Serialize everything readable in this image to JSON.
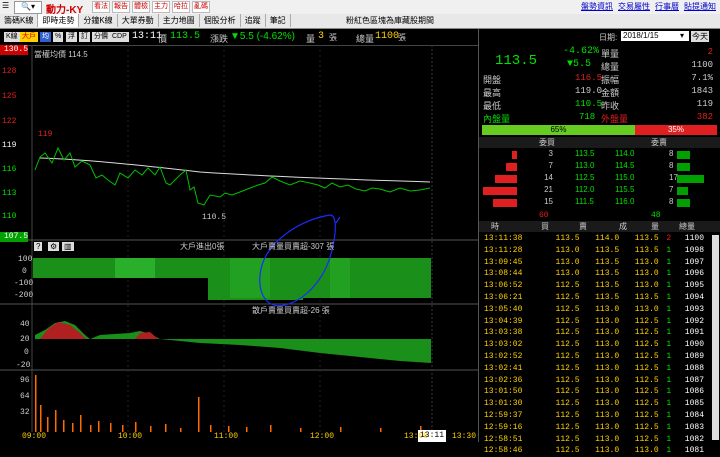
{
  "app": {
    "stock_name": "動力-KY",
    "menu": [
      "看法",
      "報告",
      "體檢",
      "主力",
      "哈拉",
      "亂碼"
    ],
    "right_links": [
      "盤勢資訊",
      "交易屬性",
      "行事曆",
      "貼提通知"
    ]
  },
  "tabs": [
    "籌碼K線",
    "即時走勢",
    "分鐘K線",
    "大單券動",
    "主力地圖",
    "個股分析",
    "追蹤",
    "筆記"
  ],
  "notice": "粉紅色區塊為庫藏股期間",
  "chart_toolbar": {
    "buttons": [
      "K線",
      "大戶",
      "均",
      "%",
      "浮",
      "訂",
      "分價",
      "CDP"
    ],
    "time": "13:11",
    "price_label": "價",
    "price": "113.5",
    "change_label": "漲跌",
    "change": "▼5.5 (-4.62%)",
    "volume_label": "量",
    "volume": "3",
    "volume_unit": "張",
    "total_label": "總量",
    "total": "1100",
    "total_unit": "張"
  },
  "main_chart": {
    "avg_label": "當權均價 114.5",
    "y_labels": [
      "130.5",
      "128",
      "125",
      "122",
      "119",
      "116",
      "113",
      "110",
      "107.5"
    ],
    "high_marker": "119",
    "low_marker": "110.5",
    "ref_price": "119",
    "top_label": "130.5",
    "bottom_label": "107.5"
  },
  "sub1": {
    "label1": "大戶進出0張",
    "label2": "大戶賣量買賣超-307 張",
    "label3": "散戶賣量買賣超-26 張",
    "y_labels": [
      "100",
      "0",
      "-100",
      "-200",
      "-300"
    ]
  },
  "sub2": {
    "y_labels": [
      "40",
      "20",
      "0",
      "-20"
    ]
  },
  "sub3": {
    "y_labels": [
      "96",
      "64",
      "32"
    ]
  },
  "x_axis": {
    "labels": [
      "09:00",
      "10:00",
      "11:00",
      "12:00",
      "13:00",
      "13:30"
    ],
    "cursor": "13:11"
  },
  "right_panel": {
    "date_label": "日期:",
    "date": "2018/1/15",
    "today_btn": "今天",
    "price": "113.5",
    "pct": "-4.62%",
    "change": "▼5.5",
    "vol_label": "單量",
    "vol": "2",
    "total_label": "總量",
    "total": "1100",
    "stats": [
      {
        "k1": "開盤",
        "v1": "116.5",
        "k2": "振幅",
        "v2": "7.1%"
      },
      {
        "k1": "最高",
        "v1": "119.0",
        "k2": "金額",
        "v2": "1843"
      },
      {
        "k1": "最低",
        "v1": "110.5",
        "k2": "昨收",
        "v2": "119"
      }
    ],
    "inner_label": "內盤量",
    "inner": "718",
    "outer_label": "外盤量",
    "outer": "382",
    "inner_pct": "65%",
    "outer_pct": "35%",
    "bid_title": "委買",
    "ask_title": "委賣",
    "book": [
      {
        "bq": "3",
        "bp": "113.5",
        "ap": "114.0",
        "aq": "8"
      },
      {
        "bq": "7",
        "bp": "113.0",
        "ap": "114.5",
        "aq": "8"
      },
      {
        "bq": "14",
        "bp": "112.5",
        "ap": "115.0",
        "aq": "17"
      },
      {
        "bq": "21",
        "bp": "112.0",
        "ap": "115.5",
        "aq": "7"
      },
      {
        "bq": "15",
        "bp": "111.5",
        "ap": "116.0",
        "aq": "8"
      }
    ],
    "book_total_bid": "60",
    "book_total_ask": "48",
    "tick_headers": [
      "時",
      "買",
      "賣",
      "成",
      "量",
      "總量"
    ],
    "ticks": [
      [
        "13:11:38",
        "113.5",
        "114.0",
        "113.5",
        "2",
        "1100"
      ],
      [
        "13:11:28",
        "113.0",
        "113.5",
        "113.5",
        "1",
        "1098"
      ],
      [
        "13:09:45",
        "113.0",
        "113.5",
        "113.0",
        "1",
        "1097"
      ],
      [
        "13:08:44",
        "113.0",
        "113.5",
        "113.0",
        "1",
        "1096"
      ],
      [
        "13:06:52",
        "112.5",
        "113.5",
        "113.0",
        "1",
        "1095"
      ],
      [
        "13:06:21",
        "112.5",
        "113.5",
        "113.5",
        "1",
        "1094"
      ],
      [
        "13:05:40",
        "112.5",
        "113.0",
        "113.0",
        "1",
        "1093"
      ],
      [
        "13:04:39",
        "112.5",
        "113.0",
        "112.5",
        "1",
        "1092"
      ],
      [
        "13:03:38",
        "112.5",
        "113.0",
        "112.5",
        "1",
        "1091"
      ],
      [
        "13:03:02",
        "112.5",
        "113.0",
        "112.5",
        "1",
        "1090"
      ],
      [
        "13:02:52",
        "112.5",
        "113.0",
        "112.5",
        "1",
        "1089"
      ],
      [
        "13:02:41",
        "112.5",
        "113.0",
        "112.5",
        "1",
        "1088"
      ],
      [
        "13:02:36",
        "112.5",
        "113.0",
        "112.5",
        "1",
        "1087"
      ],
      [
        "13:01:50",
        "112.5",
        "113.0",
        "112.5",
        "1",
        "1086"
      ],
      [
        "13:01:30",
        "112.5",
        "113.0",
        "112.5",
        "1",
        "1085"
      ],
      [
        "12:59:37",
        "112.5",
        "113.0",
        "112.5",
        "1",
        "1084"
      ],
      [
        "12:59:16",
        "112.5",
        "113.0",
        "112.5",
        "1",
        "1083"
      ],
      [
        "12:58:51",
        "112.5",
        "113.0",
        "112.5",
        "1",
        "1082"
      ],
      [
        "12:58:46",
        "112.5",
        "113.0",
        "113.0",
        "1",
        "1081"
      ]
    ]
  }
}
